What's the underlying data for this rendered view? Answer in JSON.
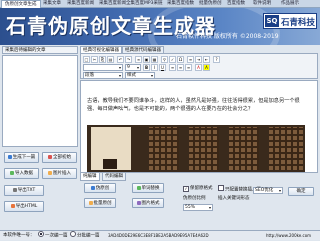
{
  "top_tabs": [
    "伪原创文章生成",
    "采集文章",
    "采集百度新闻",
    "采集百度新闻全集百度MP3采链",
    "采集百度指数",
    "批量伪原创",
    "百度指数",
    "软件说明",
    "作品展示"
  ],
  "banner": {
    "title": "石青伪原创文章生成器",
    "subtitle": "石青软件科技  版权所有 ©2008-2019",
    "logo_mark": "SQ",
    "logo_name": "石青科技"
  },
  "left_panel": {
    "header": "采集后待编辑的文章",
    "buttons": {
      "next": "生成下一篇",
      "clear": "全部初始",
      "import": "导入数据",
      "import_img": "图片插入",
      "export_txt": "导出TXT",
      "export_html": "导出HTML"
    }
  },
  "editor_tabs": [
    "经典可视化编辑器",
    "经典源代码编辑器"
  ],
  "toolbar": {
    "font_size": "9",
    "format": "段落",
    "style": "样式"
  },
  "editor": {
    "text": "古语，教导我们不要同谁争斗，这样的人，虽然凡是好强，往往活得很累，但是加息另一个很强、每日做声吆气，也是不可能的，两个很强的人在要乃在的社会分之？"
  },
  "bottom_tabs": [
    "纯编辑",
    "代码编辑"
  ],
  "bottom_controls": {
    "gen": "伪原创",
    "replace": "单词替换",
    "batch_btn": "批量原创",
    "format_btn": "图片格式",
    "keep_paragraph": "保留原格式",
    "keep_image": "只配置替换插入图",
    "ratio_label": "伪原创比例",
    "insert_label": "插入关键词形态",
    "ratio_select": "55%",
    "seo_select": "SEO优化",
    "confirm": "确定"
  },
  "status_bar": {
    "label": "本软件唯一号：",
    "opt1": "一次编一篇",
    "opt2": "分批编一篇",
    "code": "3AD4D0DE29E6C3E8F1BE2A5BAD9E95A7E4A62D",
    "url": "http://www.200ke.com"
  }
}
